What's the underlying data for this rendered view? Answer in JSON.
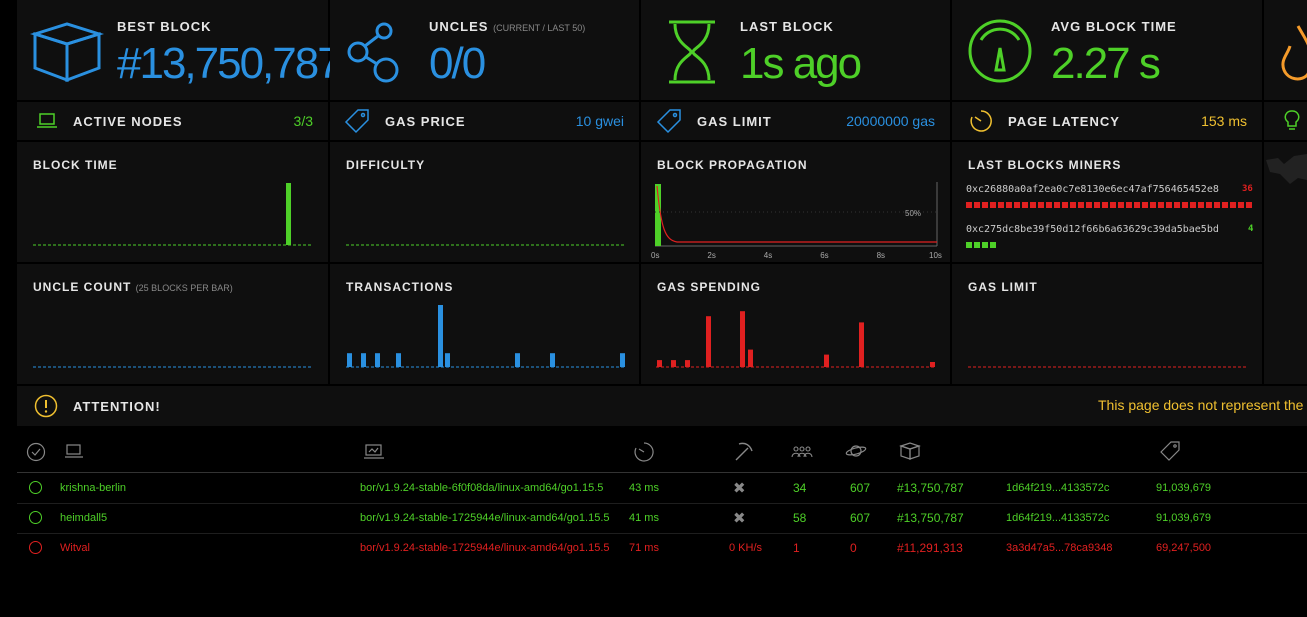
{
  "stats": {
    "best_block": {
      "label": "BEST BLOCK",
      "value": "#13,750,787",
      "icon": "cube-icon",
      "color": "#2a90e0"
    },
    "uncles": {
      "label": "UNCLES",
      "sub": "(CURRENT / LAST 50)",
      "value": "0/0",
      "icon": "share-icon",
      "color": "#2a90e0"
    },
    "last_block": {
      "label": "LAST BLOCK",
      "value": "1s ago",
      "icon": "hourglass-icon",
      "color": "#4ed028"
    },
    "avg_block_time": {
      "label": "AVG BLOCK TIME",
      "value": "2.27 s",
      "icon": "gauge-icon",
      "color": "#4ed028"
    }
  },
  "small_stats": {
    "active_nodes": {
      "label": "ACTIVE NODES",
      "value": "3/3",
      "icon": "laptop-icon"
    },
    "gas_price": {
      "label": "GAS PRICE",
      "value": "10 gwei",
      "icon": "tag-icon"
    },
    "gas_limit": {
      "label": "GAS LIMIT",
      "value": "20000000 gas",
      "icon": "tag-icon"
    },
    "page_latency": {
      "label": "PAGE LATENCY",
      "value": "153 ms",
      "icon": "timer-icon"
    }
  },
  "charts": {
    "block_time": {
      "title": "BLOCK TIME"
    },
    "difficulty": {
      "title": "DIFFICULTY"
    },
    "block_propagation": {
      "title": "BLOCK PROPAGATION",
      "pct_label": "50%",
      "x_ticks": [
        "0s",
        "2s",
        "4s",
        "6s",
        "8s",
        "10s"
      ]
    },
    "last_blocks_miners": {
      "title": "LAST BLOCKS MINERS"
    },
    "uncle_count": {
      "title": "UNCLE COUNT",
      "sub": "(25 BLOCKS PER BAR)"
    },
    "transactions": {
      "title": "TRANSACTIONS"
    },
    "gas_spending": {
      "title": "GAS SPENDING"
    },
    "gas_limit": {
      "title": "GAS LIMIT"
    }
  },
  "chart_data": [
    {
      "type": "bar",
      "name": "block_time",
      "values": [
        0,
        0,
        0,
        0,
        0,
        0,
        0,
        0,
        0,
        0,
        0,
        0,
        0,
        0,
        0,
        0,
        0,
        0,
        0,
        0,
        0,
        0,
        0,
        0,
        0,
        0,
        0,
        0,
        0,
        0,
        0,
        0,
        0,
        0,
        0,
        0,
        1,
        0,
        0,
        0
      ],
      "color": "#4ed028",
      "ylim": [
        0,
        1
      ]
    },
    {
      "type": "bar",
      "name": "difficulty",
      "values": [],
      "color": "#4ed028"
    },
    {
      "type": "bar",
      "name": "block_propagation",
      "x_ticks": [
        "0s",
        "2s",
        "4s",
        "6s",
        "8s",
        "10s"
      ],
      "values": [
        1
      ],
      "color": "#4ed028"
    },
    {
      "type": "bar",
      "name": "uncle_count",
      "values": [],
      "color": "#2a90e0"
    },
    {
      "type": "bar",
      "name": "transactions",
      "values": [
        2,
        0,
        2,
        0,
        2,
        0,
        0,
        2,
        0,
        0,
        0,
        0,
        0,
        9,
        2,
        0,
        0,
        0,
        0,
        0,
        0,
        0,
        0,
        0,
        2,
        0,
        0,
        0,
        0,
        2,
        0,
        0,
        0,
        0,
        0,
        0,
        0,
        0,
        0,
        2
      ],
      "color": "#2a90e0",
      "ylim": [
        0,
        9
      ]
    },
    {
      "type": "bar",
      "name": "gas_spending",
      "values": [
        1,
        0,
        1,
        0,
        1,
        0,
        0,
        0,
        0,
        0,
        0,
        0,
        0,
        0,
        0,
        0,
        0,
        0,
        0,
        0,
        0,
        0,
        0,
        0,
        0,
        0,
        0,
        0,
        0,
        0,
        0,
        0,
        0,
        0,
        0,
        0,
        0,
        0,
        0,
        0
      ],
      "color": "#e02020",
      "ylim": [
        0,
        9
      ]
    },
    {
      "type": "bar",
      "name": "gas_limit",
      "values": [],
      "color": "#e02020"
    }
  ],
  "miners": [
    {
      "address": "0xc26880a0af2ea0c7e8130e6ec47af756465452e8",
      "count": "36",
      "color": "#e02020"
    },
    {
      "address": "0xc275dc8be39f50d12f66b6a63629c39da5bae5bd",
      "count": "4",
      "color": "#4ed028"
    }
  ],
  "attention": {
    "label": "ATTENTION!",
    "message": "This page does not represent the"
  },
  "nodes": [
    {
      "name": "krishna-berlin",
      "client": "bor/v1.9.24-stable-6f0f08da/linux-amd64/go1.15.5",
      "latency": "43 ms",
      "mining": "",
      "peers": "34",
      "pending": "607",
      "block": "#13,750,787",
      "hash": "1d64f219...4133572c",
      "difficulty": "91,039,679",
      "status": "online"
    },
    {
      "name": "heimdall5",
      "client": "bor/v1.9.24-stable-1725944e/linux-amd64/go1.15.5",
      "latency": "41 ms",
      "mining": "",
      "peers": "58",
      "pending": "607",
      "block": "#13,750,787",
      "hash": "1d64f219...4133572c",
      "difficulty": "91,039,679",
      "status": "online"
    },
    {
      "name": "Witval",
      "client": "bor/v1.9.24-stable-1725944e/linux-amd64/go1.15.5",
      "latency": "71 ms",
      "mining": "0 KH/s",
      "peers": "1",
      "pending": "0",
      "block": "#11,291,313",
      "hash": "3a3d47a5...78ca9348",
      "difficulty": "69,247,500",
      "status": "offline"
    }
  ]
}
